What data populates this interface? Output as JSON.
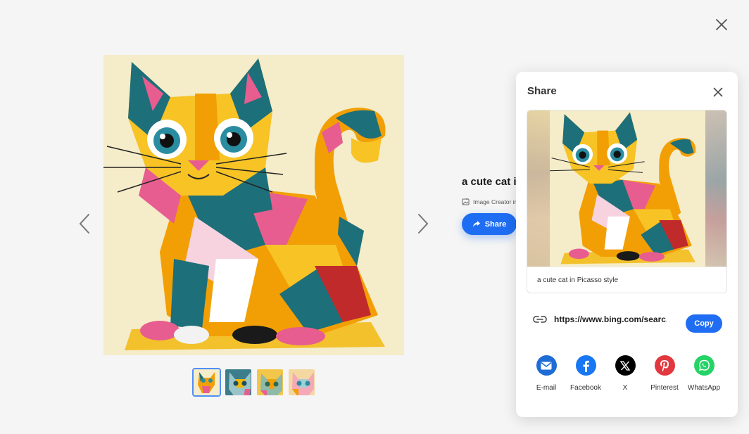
{
  "viewer": {
    "image_title": "a cute cat in Picasso style",
    "image_title_visible": "a cute cat ir",
    "source_label": "Image Creator in",
    "share_label": "Share",
    "thumbnails": [
      "thumbnail-1",
      "thumbnail-2",
      "thumbnail-3",
      "thumbnail-4"
    ],
    "active_thumbnail": 0
  },
  "share_panel": {
    "title": "Share",
    "caption": "a cute cat in Picasso style",
    "link": "https://www.bing.com/searc...",
    "copy_label": "Copy",
    "socials": [
      {
        "label": "E-mail",
        "icon": "email-icon",
        "color": "#1f6cd6"
      },
      {
        "label": "Facebook",
        "icon": "facebook-icon",
        "color": "#1877f2"
      },
      {
        "label": "X",
        "icon": "x-icon",
        "color": "#000000"
      },
      {
        "label": "Pinterest",
        "icon": "pinterest-icon",
        "color": "#e0383e"
      },
      {
        "label": "WhatsApp",
        "icon": "whatsapp-icon",
        "color": "#25d366"
      }
    ]
  },
  "colors": {
    "accent": "#1f6df2",
    "background": "#f5f5f5"
  }
}
